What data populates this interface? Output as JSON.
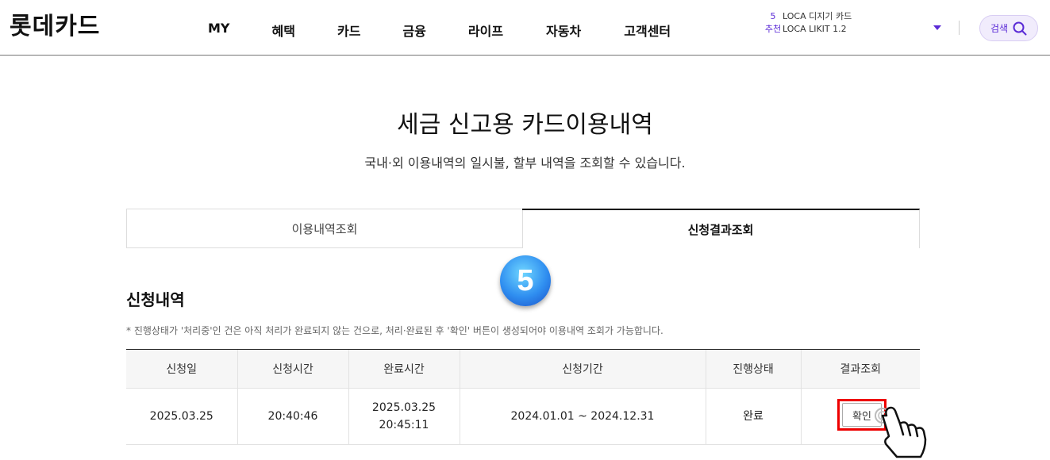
{
  "header": {
    "logo": "롯데카드",
    "nav": [
      "MY",
      "혜택",
      "카드",
      "금융",
      "라이프",
      "자동차",
      "고객센터"
    ],
    "promo": [
      {
        "num": "5",
        "text": "LOCA 디지기 카드"
      },
      {
        "num": "추천",
        "text": "LOCA LIKIT 1.2"
      }
    ],
    "search_label": "검색"
  },
  "page": {
    "title": "세금 신고용 카드이용내역",
    "subtitle": "국내·외 이용내역의 일시불, 할부 내역을 조회할 수 있습니다."
  },
  "tabs": [
    {
      "label": "이용내역조회",
      "active": false
    },
    {
      "label": "신청결과조회",
      "active": true
    }
  ],
  "step_badge": "5",
  "section": {
    "title": "신청내역",
    "note": "* 진행상태가 '처리중'인 건은 아직 처리가 완료되지 않는 건으로, 처리·완료된 후 '확인' 버튼이 생성되어야 이용내역 조회가 가능합니다."
  },
  "table": {
    "headers": [
      "신청일",
      "신청시간",
      "완료시간",
      "신청기간",
      "진행상태",
      "결과조회"
    ],
    "rows": [
      {
        "date": "2025.03.25",
        "time": "20:40:46",
        "done_date": "2025.03.25",
        "done_time": "20:45:11",
        "period": "2024.01.01 ~ 2024.12.31",
        "status": "완료",
        "action": "확인"
      }
    ]
  }
}
